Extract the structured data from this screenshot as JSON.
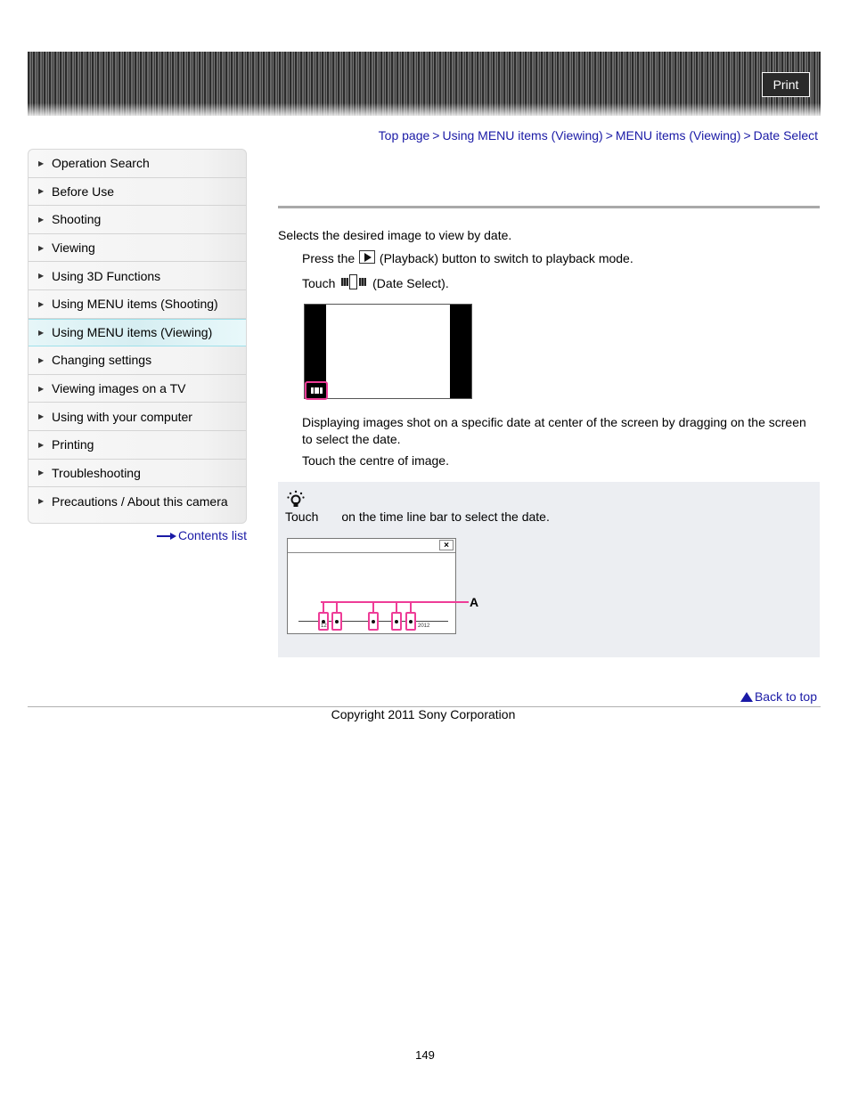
{
  "header": {
    "print_label": "Print"
  },
  "breadcrumb": {
    "items": [
      "Top page",
      "Using MENU items (Viewing)",
      "MENU items (Viewing)",
      "Date Select"
    ],
    "separator": ">"
  },
  "sidebar": {
    "items": [
      {
        "label": "Operation Search"
      },
      {
        "label": "Before Use"
      },
      {
        "label": "Shooting"
      },
      {
        "label": "Viewing"
      },
      {
        "label": "Using 3D Functions"
      },
      {
        "label": "Using MENU items (Shooting)"
      },
      {
        "label": "Using MENU items (Viewing)",
        "active": true
      },
      {
        "label": "Changing settings"
      },
      {
        "label": "Viewing images on a TV"
      },
      {
        "label": "Using with your computer"
      },
      {
        "label": "Printing"
      },
      {
        "label": "Troubleshooting"
      },
      {
        "label": "Precautions / About this camera"
      }
    ],
    "contents_link": "Contents list"
  },
  "main": {
    "intro": "Selects the desired image to view by date.",
    "step1": {
      "before": "Press the",
      "after": "(Playback) button to switch to playback mode."
    },
    "step2": {
      "before": "Touch",
      "after": "(Date Select)."
    },
    "description": "Displaying images shot on a specific date at center of the screen by dragging on the screen to select the date.",
    "step3": "Touch the centre of image.",
    "hint": {
      "before": "Touch",
      "after": "on the time line bar to select the date.",
      "callout_label": "A",
      "timeline_labels": [
        "12",
        "2012"
      ]
    }
  },
  "footer": {
    "back_to_top": "Back to top",
    "copyright": "Copyright 2011 Sony Corporation",
    "page_number": "149"
  },
  "colors": {
    "link": "#1a1aa6",
    "highlight": "#ee3c97",
    "hint_bg": "#eceef2",
    "active_item_border": "#9ee0ea"
  }
}
